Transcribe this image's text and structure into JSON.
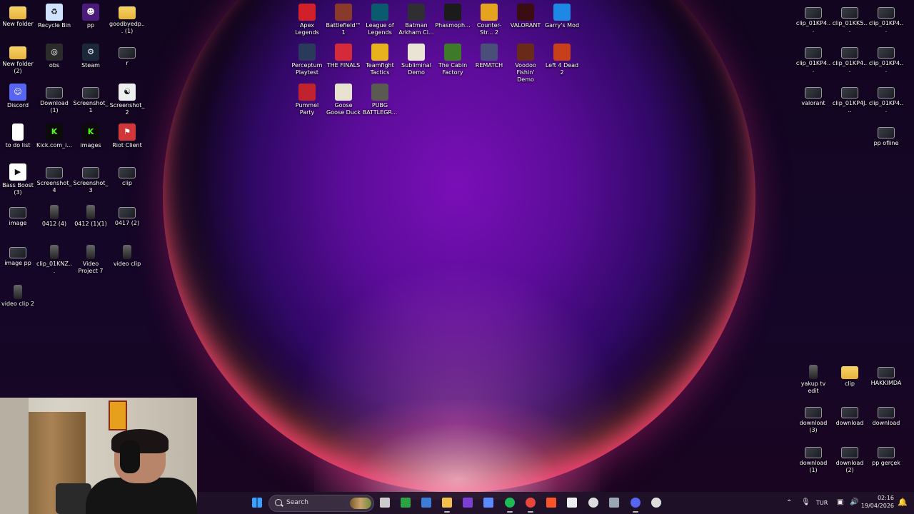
{
  "desktop": {
    "left_icons": [
      {
        "label": "New folder",
        "icon": "folder-icon"
      },
      {
        "label": "Recycle Bin",
        "icon": "recycle-bin-icon"
      },
      {
        "label": "pp",
        "icon": "avatar-icon"
      },
      {
        "label": "goodbyedp... (1)",
        "icon": "folder-icon"
      },
      {
        "label": "New folder (2)",
        "icon": "folder-icon"
      },
      {
        "label": "obs",
        "icon": "obs-icon"
      },
      {
        "label": "Steam",
        "icon": "steam-icon"
      },
      {
        "label": "r",
        "icon": "image-icon"
      },
      {
        "label": "Discord",
        "icon": "discord-icon"
      },
      {
        "label": "Download (1)",
        "icon": "image-icon"
      },
      {
        "label": "Screenshot_1",
        "icon": "image-icon"
      },
      {
        "label": "Screenshot_2",
        "icon": "yin-yang-icon"
      },
      {
        "label": "to do list",
        "icon": "text-file-icon"
      },
      {
        "label": "Kick.com_i...",
        "icon": "kick-icon"
      },
      {
        "label": "images",
        "icon": "kick-icon"
      },
      {
        "label": "Riot Client",
        "icon": "riot-client-icon"
      },
      {
        "label": "Bass Boost (3)",
        "icon": "audio-file-icon"
      },
      {
        "label": "Screenshot_4",
        "icon": "image-icon"
      },
      {
        "label": "Screenshot_3",
        "icon": "image-icon"
      },
      {
        "label": "clip",
        "icon": "image-icon"
      },
      {
        "label": "image",
        "icon": "image-icon"
      },
      {
        "label": "0412 (4)",
        "icon": "video-icon"
      },
      {
        "label": "0412 (1)(1)",
        "icon": "video-icon"
      },
      {
        "label": "0417 (2)",
        "icon": "image-icon"
      },
      {
        "label": "image pp",
        "icon": "image-icon"
      },
      {
        "label": "clip_01KNZ...",
        "icon": "video-icon"
      },
      {
        "label": "Video Project 7",
        "icon": "video-icon"
      },
      {
        "label": "video clip",
        "icon": "video-icon"
      },
      {
        "label": "video clip 2",
        "icon": "video-icon"
      }
    ],
    "game_icons": [
      {
        "label": "Apex Legends",
        "icon": "apex-legends-icon",
        "color": "#d2202a"
      },
      {
        "label": "Battlefield™ 1",
        "icon": "battlefield-icon",
        "color": "#8a3a2a"
      },
      {
        "label": "League of Legends",
        "icon": "league-of-legends-icon",
        "color": "#0a5b6e"
      },
      {
        "label": "Batman Arkham Ci...",
        "icon": "batman-icon",
        "color": "#2e2e33"
      },
      {
        "label": "Phasmoph...",
        "icon": "phasmophobia-icon",
        "color": "#1b1b1b"
      },
      {
        "label": "Counter-Str... 2",
        "icon": "counter-strike-icon",
        "color": "#e6a31e"
      },
      {
        "label": "VALORANT",
        "icon": "valorant-icon",
        "color": "#3a0d12"
      },
      {
        "label": "Garry's Mod",
        "icon": "garrys-mod-icon",
        "color": "#1e88e5"
      },
      {
        "label": "Perceptum Playtest",
        "icon": "perceptum-icon",
        "color": "#2a3a5a"
      },
      {
        "label": "THE FINALS",
        "icon": "the-finals-icon",
        "color": "#d42a3a"
      },
      {
        "label": "Teamfight Tactics",
        "icon": "teamfight-tactics-icon",
        "color": "#e8b21e"
      },
      {
        "label": "Subliminal Demo",
        "icon": "subliminal-icon",
        "color": "#e9e4d4"
      },
      {
        "label": "The Cabin Factory",
        "icon": "cabin-factory-icon",
        "color": "#3f7a2a"
      },
      {
        "label": "REMATCH",
        "icon": "rematch-icon",
        "color": "#4a4f7a"
      },
      {
        "label": "Voodoo Fishin' Demo",
        "icon": "voodoo-fishin-icon",
        "color": "#6a2a1a"
      },
      {
        "label": "Left 4 Dead 2",
        "icon": "left-4-dead-icon",
        "color": "#c8401a"
      },
      {
        "label": "Pummel Party",
        "icon": "pummel-party-icon",
        "color": "#c0232e"
      },
      {
        "label": "Goose Goose Duck",
        "icon": "goose-goose-duck-icon",
        "color": "#e8e2d0"
      },
      {
        "label": "PUBG BATTLEGR...",
        "icon": "pubg-icon",
        "color": "#5a5a50"
      }
    ],
    "right_top_icons": [
      {
        "label": "clip_01KP4..."
      },
      {
        "label": "clip_01KK5..."
      },
      {
        "label": "clip_01KP4..."
      },
      {
        "label": "clip_01KP4..."
      },
      {
        "label": "clip_01KP4..."
      },
      {
        "label": "clip_01KP4..."
      },
      {
        "label": "valorant"
      },
      {
        "label": "clip_01KP4J..."
      },
      {
        "label": "clip_01KP4..."
      },
      {
        "label": "pp ofline"
      }
    ],
    "right_bottom_icons": [
      {
        "label": "yakup tv edit",
        "icon": "video-icon"
      },
      {
        "label": "clip",
        "icon": "folder-icon"
      },
      {
        "label": "HAKKIMDA",
        "icon": "image-icon"
      },
      {
        "label": "download (3)",
        "icon": "image-icon"
      },
      {
        "label": "download",
        "icon": "image-icon"
      },
      {
        "label": "download",
        "icon": "image-icon"
      },
      {
        "label": "download (1)",
        "icon": "image-icon"
      },
      {
        "label": "download (2)",
        "icon": "image-icon"
      },
      {
        "label": "pp gerçek",
        "icon": "image-icon"
      }
    ]
  },
  "taskbar": {
    "search_label": "Search",
    "apps": [
      {
        "name": "start-button",
        "icon": "windows-icon",
        "color": "#3aa0ff"
      },
      {
        "name": "task-view",
        "icon": "task-view-icon",
        "color": "#cccccc"
      },
      {
        "name": "xbox",
        "icon": "xbox-icon",
        "color": "#2ca243"
      },
      {
        "name": "microsoft-store",
        "icon": "store-icon",
        "color": "#3b7dd8"
      },
      {
        "name": "file-explorer",
        "icon": "folder-icon",
        "color": "#f2c14b"
      },
      {
        "name": "clipchamp",
        "icon": "clipchamp-icon",
        "color": "#7b3fd1"
      },
      {
        "name": "copilot",
        "icon": "copilot-icon",
        "color": "#5b8cff"
      },
      {
        "name": "spotify",
        "icon": "spotify-icon",
        "color": "#1db954"
      },
      {
        "name": "chrome",
        "icon": "chrome-icon",
        "color": "#e8453c"
      },
      {
        "name": "brave",
        "icon": "brave-icon",
        "color": "#fb542b"
      },
      {
        "name": "capcut",
        "icon": "capcut-icon",
        "color": "#eeeeee"
      },
      {
        "name": "chatgpt",
        "icon": "chatgpt-icon",
        "color": "#dddddd"
      },
      {
        "name": "settings",
        "icon": "settings-icon",
        "color": "#9aa6b5"
      },
      {
        "name": "discord",
        "icon": "discord-icon",
        "color": "#5865f2"
      },
      {
        "name": "obs",
        "icon": "obs-icon",
        "color": "#dddddd"
      }
    ],
    "tray": {
      "language": "TUR",
      "time": "02:16",
      "date": "19/04/2026"
    }
  }
}
